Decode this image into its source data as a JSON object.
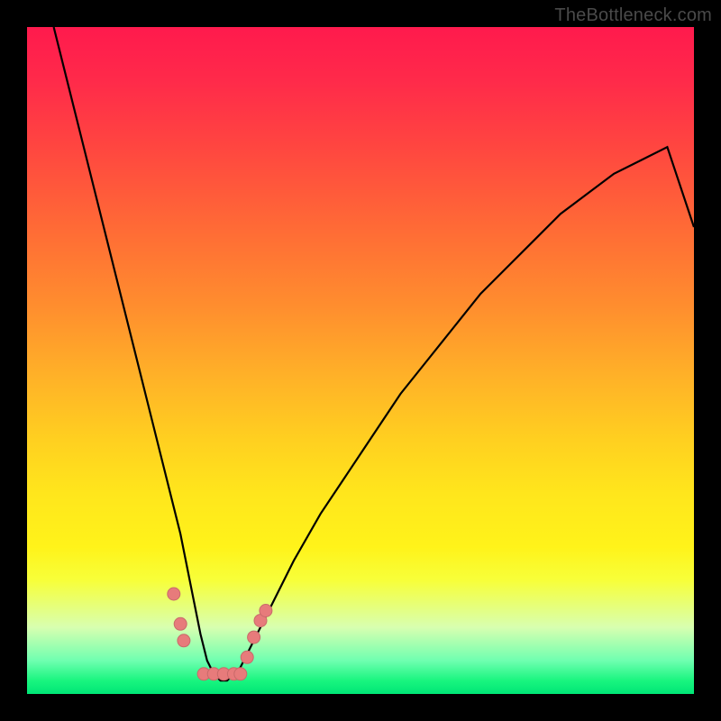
{
  "watermark": "TheBottleneck.com",
  "colors": {
    "frame": "#000000",
    "curve": "#000000",
    "marker_fill": "#e77b7b",
    "marker_stroke": "#c86a6a"
  },
  "chart_data": {
    "type": "line",
    "title": "",
    "xlabel": "",
    "ylabel": "",
    "xlim": [
      0,
      100
    ],
    "ylim": [
      0,
      100
    ],
    "series": [
      {
        "name": "bottleneck-curve",
        "x": [
          4,
          6,
          8,
          10,
          12,
          14,
          16,
          18,
          20,
          22,
          23,
          24,
          25,
          26,
          27,
          28,
          29,
          30,
          31,
          32,
          33,
          34,
          36,
          38,
          40,
          44,
          48,
          52,
          56,
          60,
          64,
          68,
          72,
          76,
          80,
          84,
          88,
          92,
          96,
          100
        ],
        "y": [
          100,
          92,
          84,
          76,
          68,
          60,
          52,
          44,
          36,
          28,
          24,
          19,
          14,
          9,
          5,
          3,
          2,
          2,
          3,
          4,
          6,
          8,
          12,
          16,
          20,
          27,
          33,
          39,
          45,
          50,
          55,
          60,
          64,
          68,
          72,
          75,
          78,
          80,
          82,
          70
        ]
      }
    ],
    "markers": [
      {
        "x": 22.0,
        "y": 15.0
      },
      {
        "x": 23.0,
        "y": 10.5
      },
      {
        "x": 23.5,
        "y": 8.0
      },
      {
        "x": 26.5,
        "y": 3.0
      },
      {
        "x": 28.0,
        "y": 3.0
      },
      {
        "x": 29.5,
        "y": 3.0
      },
      {
        "x": 31.0,
        "y": 3.0
      },
      {
        "x": 32.0,
        "y": 3.0
      },
      {
        "x": 33.0,
        "y": 5.5
      },
      {
        "x": 34.0,
        "y": 8.5
      },
      {
        "x": 35.0,
        "y": 11.0
      },
      {
        "x": 35.8,
        "y": 12.5
      }
    ],
    "marker_radius_px": 7
  }
}
